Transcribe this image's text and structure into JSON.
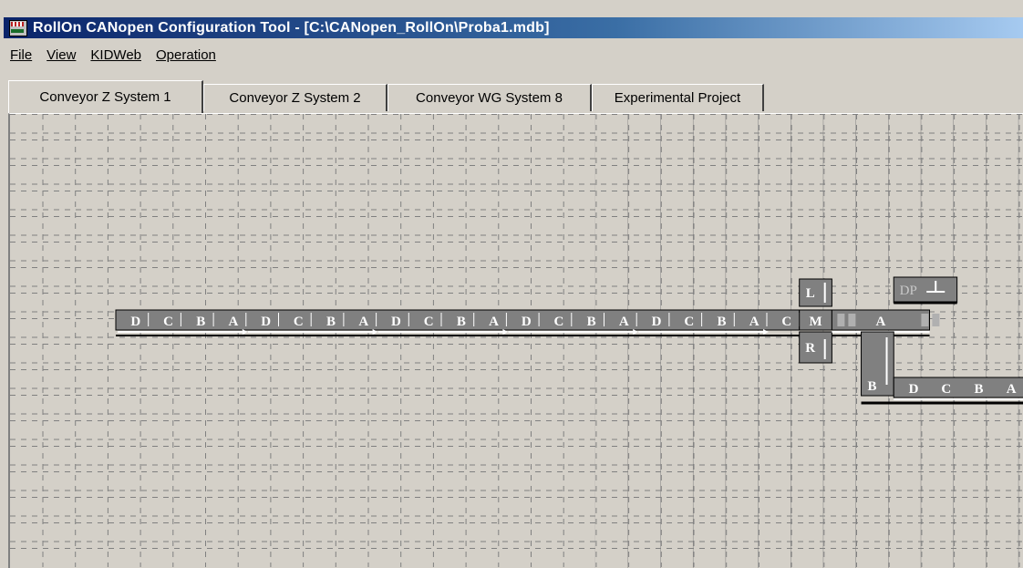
{
  "window": {
    "title": "RollOn CANopen Configuration Tool - [C:\\CANopen_RollOn\\Proba1.mdb]"
  },
  "menu": {
    "items": [
      "File",
      "View",
      "KIDWeb",
      "Operation"
    ]
  },
  "tabs": [
    {
      "label": "Conveyor Z System 1",
      "active": true
    },
    {
      "label": "Conveyor Z System 2",
      "active": false
    },
    {
      "label": "Conveyor WG System 8",
      "active": false
    },
    {
      "label": "Experimental Project",
      "active": false
    }
  ],
  "conveyor": {
    "main_line_labels": [
      "D",
      "C",
      "B",
      "A",
      "D",
      "C",
      "B",
      "A",
      "D",
      "C",
      "B",
      "A",
      "D",
      "C",
      "B",
      "A",
      "D",
      "C",
      "B",
      "A",
      "C"
    ],
    "merge_label": "M",
    "left_label": "L",
    "right_label": "R",
    "after_merge_label": "A",
    "branch_label": "B",
    "lower_line_labels": [
      "D",
      "C",
      "B",
      "A"
    ],
    "dp_label": "DP"
  },
  "colors": {
    "segment_fill": "#808080",
    "segment_dark": "#000000",
    "grid_line": "#808080",
    "background": "#d4d0c8",
    "titlebar_start": "#0a246a"
  }
}
